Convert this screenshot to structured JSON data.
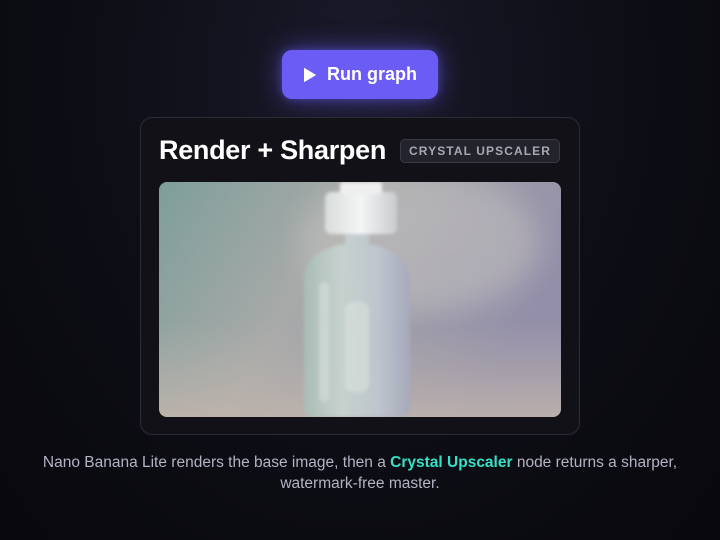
{
  "run_button": {
    "label": "Run graph",
    "icon": "play-icon"
  },
  "card": {
    "title": "Render + Sharpen",
    "badge": "CRYSTAL UPSCALER",
    "image_subject": "glass dropper bottle"
  },
  "caption": {
    "before": "Nano Banana Lite renders the base image, then a ",
    "highlight": "Crystal Upscaler",
    "after": " node returns a sharper, watermark-free master."
  },
  "colors": {
    "accent": "#6b5cf5",
    "highlight": "#36e0c6",
    "background": "#0d0d15"
  }
}
